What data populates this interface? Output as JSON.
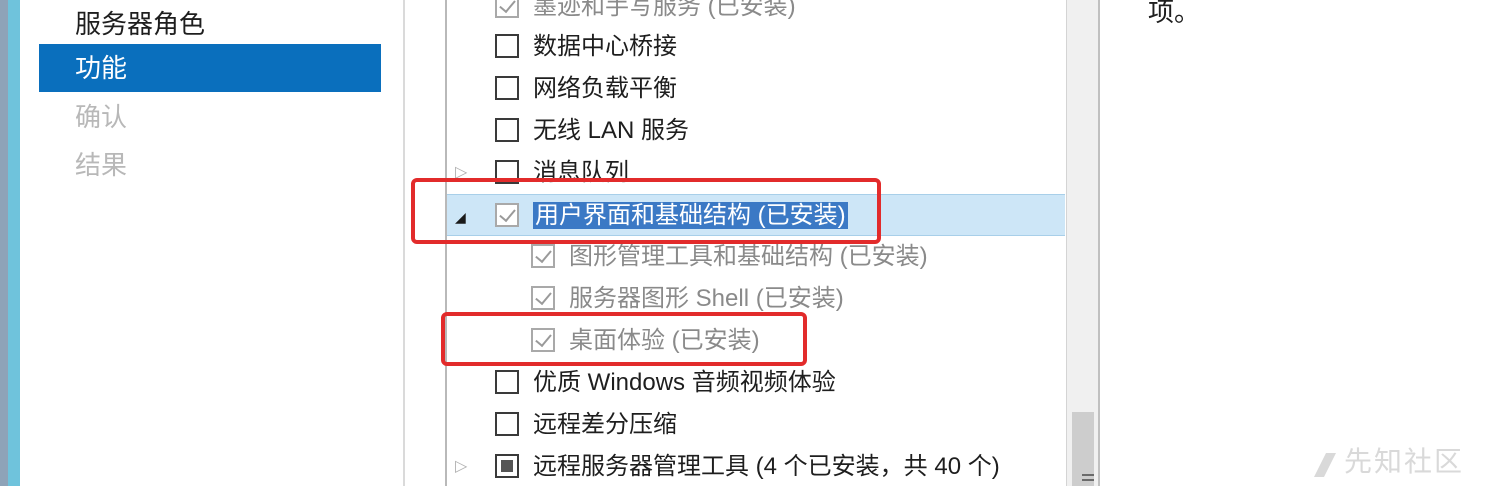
{
  "nav": {
    "items": [
      {
        "label": "服务器角色",
        "state": "normal"
      },
      {
        "label": "功能",
        "state": "active"
      },
      {
        "label": "确认",
        "state": "disabled"
      },
      {
        "label": "结果",
        "state": "disabled"
      }
    ]
  },
  "features": {
    "rows": [
      {
        "label": "墨迹和手写服务 (已安装)",
        "checked": true,
        "installed": true
      },
      {
        "label": "数据中心桥接",
        "checked": false
      },
      {
        "label": "网络负载平衡",
        "checked": false
      },
      {
        "label": "无线 LAN 服务",
        "checked": false
      },
      {
        "label": "消息队列",
        "checked": false,
        "expandable": true
      },
      {
        "label": "用户界面和基础结构 (已安装)",
        "checked": true,
        "expanded": true,
        "selected": true
      },
      {
        "label": "图形管理工具和基础结构 (已安装)",
        "checked": true,
        "child": true
      },
      {
        "label": "服务器图形 Shell (已安装)",
        "checked": true,
        "child": true
      },
      {
        "label": "桌面体验 (已安装)",
        "checked": true,
        "child": true
      },
      {
        "label": "优质 Windows 音频视频体验",
        "checked": false
      },
      {
        "label": "远程差分压缩",
        "checked": false
      },
      {
        "label": "远程服务器管理工具 (4 个已安装，共 40 个)",
        "checked": "partial",
        "expandable": true
      }
    ]
  },
  "description": {
    "text": "项。"
  },
  "watermark": {
    "text": "先知社区"
  },
  "colors": {
    "accent": "#0a6fbd",
    "callout": "#e22b2b",
    "selection": "#cde6f7"
  }
}
